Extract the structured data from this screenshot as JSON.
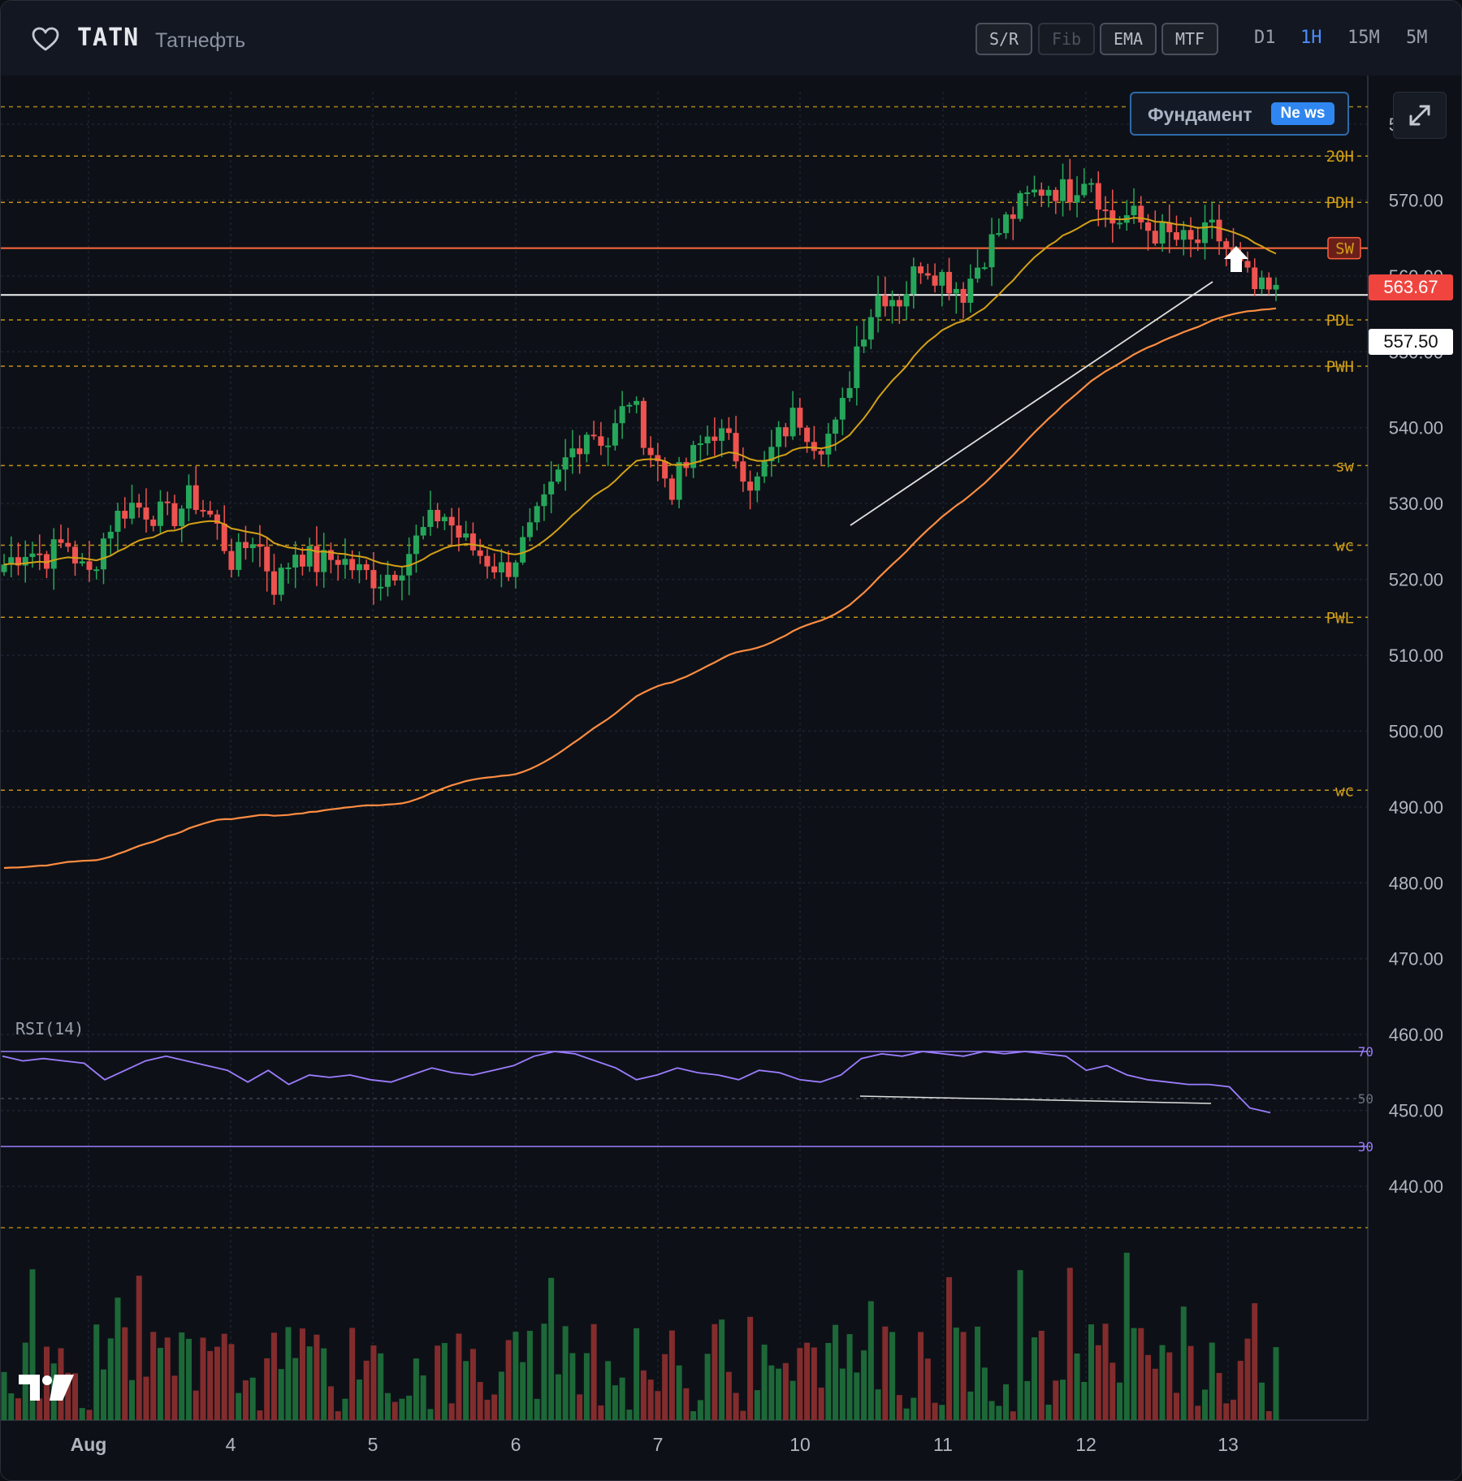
{
  "header": {
    "ticker": "TATN",
    "company": "Татнефть",
    "tools": [
      "S/R",
      "Fib",
      "EMA",
      "MTF"
    ],
    "timeframes": [
      "D1",
      "1H",
      "15M",
      "5M"
    ],
    "active_timeframe": "1H"
  },
  "fundament": {
    "label": "Фундамент",
    "badge": "Ne ws"
  },
  "price_axis": [
    "580.00",
    "570.00",
    "560.00",
    "550.00",
    "540.00",
    "530.00",
    "520.00",
    "510.00",
    "500.00",
    "490.00",
    "480.00",
    "470.00",
    "460.00",
    "450.00",
    "440.00"
  ],
  "date_axis": [
    "Aug",
    "4",
    "5",
    "6",
    "7",
    "10",
    "11",
    "12",
    "13"
  ],
  "current_price": "563.67",
  "cursor_price": "557.50",
  "levels": [
    {
      "label": "20H",
      "price": 575.8
    },
    {
      "label": "PDH",
      "price": 569.7
    },
    {
      "label": "SW",
      "price": 563.67
    },
    {
      "label": "PDL",
      "price": 554.2
    },
    {
      "label": "PWH",
      "price": 548.1
    },
    {
      "label": "sw",
      "price": 535.0
    },
    {
      "label": "wc",
      "price": 524.5
    },
    {
      "label": "PWL",
      "price": 515.0
    },
    {
      "label": "wc",
      "price": 492.2
    }
  ],
  "rsi": {
    "title": "RSI(14)",
    "upper": "70",
    "mid": "50",
    "lower": "30"
  },
  "colors": {
    "up": "#26a65b",
    "down": "#ef5350",
    "level": "#d4a017",
    "ema_fast": "#d4a017",
    "ema_slow": "#ff8c42",
    "rsi": "#9c7dff",
    "current": "#f4504b"
  },
  "chart_data": {
    "type": "candlestick",
    "x_ticks": [
      "Aug",
      "4",
      "5",
      "6",
      "7",
      "10",
      "11",
      "12",
      "13"
    ],
    "ylim": [
      435,
      585
    ],
    "approx_closes": [
      522,
      524,
      523,
      525,
      520,
      527,
      530,
      529,
      528,
      531,
      528,
      522,
      526,
      519,
      524,
      522,
      523,
      521,
      520,
      522,
      526,
      529,
      525,
      523,
      521,
      525,
      530,
      536,
      540,
      538,
      544,
      537,
      532,
      536,
      540,
      537,
      532,
      538,
      542,
      538,
      540,
      552,
      558,
      557,
      562,
      560,
      558,
      563,
      567,
      570,
      572,
      571,
      574,
      567,
      568,
      566,
      565,
      564,
      566,
      562,
      558,
      557.5
    ],
    "rsi_values": [
      68,
      66,
      67,
      66,
      65,
      58,
      62,
      66,
      68,
      66,
      64,
      62,
      57,
      62,
      56,
      60,
      59,
      60,
      58,
      57,
      60,
      63,
      61,
      60,
      62,
      64,
      68,
      70,
      69,
      66,
      63,
      58,
      60,
      63,
      61,
      60,
      58,
      62,
      61,
      58,
      57,
      60,
      67,
      69,
      68,
      70,
      69,
      68,
      70,
      69,
      70,
      69,
      68,
      62,
      64,
      60,
      58,
      57,
      56,
      56,
      55,
      46,
      44
    ]
  }
}
